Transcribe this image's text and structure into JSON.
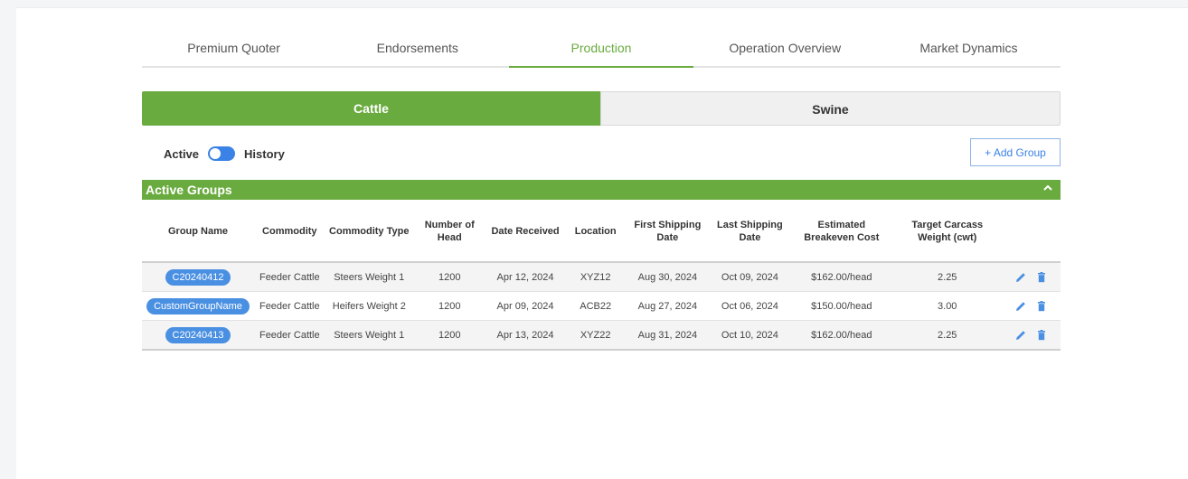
{
  "tabs": [
    {
      "label": "Premium Quoter",
      "active": false
    },
    {
      "label": "Endorsements",
      "active": false
    },
    {
      "label": "Production",
      "active": true
    },
    {
      "label": "Operation Overview",
      "active": false
    },
    {
      "label": "Market Dynamics",
      "active": false
    }
  ],
  "species": {
    "cattle": "Cattle",
    "swine": "Swine",
    "selected": "Cattle"
  },
  "switch": {
    "left_label": "Active",
    "right_label": "History"
  },
  "add_group_label": "+ Add Group",
  "section": {
    "title": "Active Groups",
    "collapse_icon": "chevron-up-icon"
  },
  "table": {
    "headers": [
      "Group Name",
      "Commodity",
      "Commodity Type",
      "Number of Head",
      "Date Received",
      "Location",
      "First Shipping Date",
      "Last Shipping Date",
      "Estimated Breakeven Cost",
      "Target Carcass Weight (cwt)"
    ],
    "rows": [
      {
        "group": "C20240412",
        "commodity": "Feeder Cattle",
        "type": "Steers Weight 1",
        "head": "1200",
        "received": "Apr 12, 2024",
        "location": "XYZ12",
        "first_ship": "Aug 30, 2024",
        "last_ship": "Oct 09, 2024",
        "breakeven": "$162.00/head",
        "weight": "2.25"
      },
      {
        "group": "CustomGroupName",
        "commodity": "Feeder Cattle",
        "type": "Heifers Weight 2",
        "head": "1200",
        "received": "Apr 09, 2024",
        "location": "ACB22",
        "first_ship": "Aug 27, 2024",
        "last_ship": "Oct 06, 2024",
        "breakeven": "$150.00/head",
        "weight": "3.00"
      },
      {
        "group": "C20240413",
        "commodity": "Feeder Cattle",
        "type": "Steers Weight 1",
        "head": "1200",
        "received": "Apr 13, 2024",
        "location": "XYZ22",
        "first_ship": "Aug 31, 2024",
        "last_ship": "Oct 10, 2024",
        "breakeven": "$162.00/head",
        "weight": "2.25"
      }
    ]
  },
  "colors": {
    "accent_green": "#6aab3f",
    "accent_blue": "#4a90e2"
  }
}
